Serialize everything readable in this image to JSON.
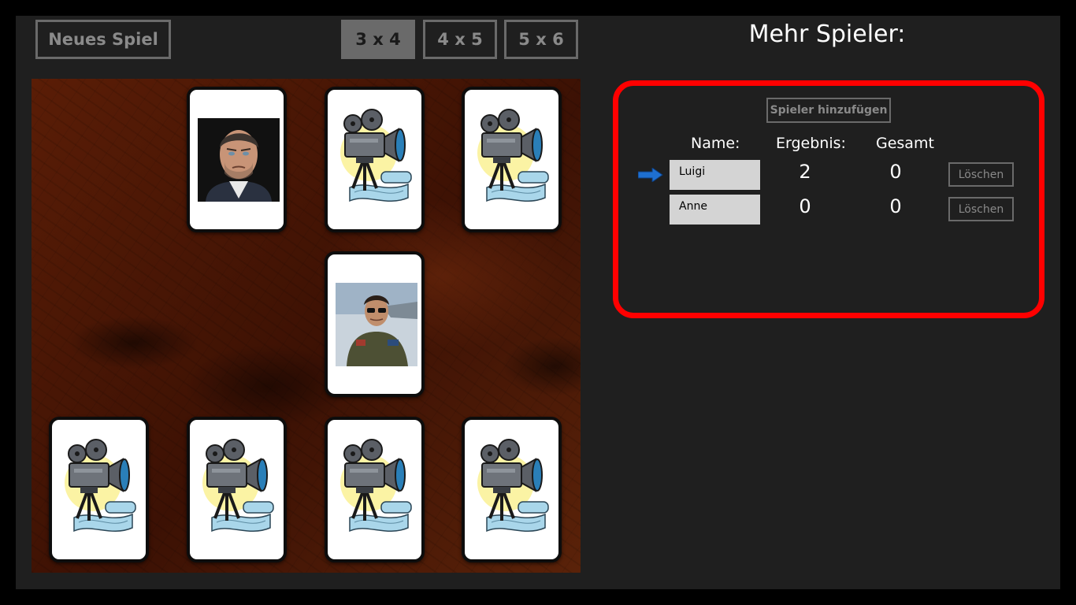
{
  "toolbar": {
    "new_game_label": "Neues Spiel",
    "sizes": [
      {
        "label": "3 x 4",
        "active": true
      },
      {
        "label": "4 x 5",
        "active": false
      },
      {
        "label": "5 x 6",
        "active": false
      }
    ]
  },
  "board": {
    "grid": "3 x 4",
    "cards": [
      {
        "row": 0,
        "col": 0,
        "state": "removed"
      },
      {
        "row": 0,
        "col": 1,
        "state": "face-up",
        "image": "man-portrait-photo"
      },
      {
        "row": 0,
        "col": 2,
        "state": "face-down",
        "image": "movie-camera-card-back"
      },
      {
        "row": 0,
        "col": 3,
        "state": "face-down",
        "image": "movie-camera-card-back"
      },
      {
        "row": 1,
        "col": 0,
        "state": "removed"
      },
      {
        "row": 1,
        "col": 1,
        "state": "removed"
      },
      {
        "row": 1,
        "col": 2,
        "state": "face-up",
        "image": "pilot-photo"
      },
      {
        "row": 1,
        "col": 3,
        "state": "removed"
      },
      {
        "row": 2,
        "col": 0,
        "state": "face-down",
        "image": "movie-camera-card-back"
      },
      {
        "row": 2,
        "col": 1,
        "state": "face-down",
        "image": "movie-camera-card-back"
      },
      {
        "row": 2,
        "col": 2,
        "state": "face-down",
        "image": "movie-camera-card-back"
      },
      {
        "row": 2,
        "col": 3,
        "state": "face-down",
        "image": "movie-camera-card-back"
      }
    ]
  },
  "multiplayer": {
    "title": "Mehr Spieler:",
    "add_player_label": "Spieler hinzufügen",
    "headers": {
      "name": "Name:",
      "score": "Ergebnis:",
      "total": "Gesamt"
    },
    "current_player_icon": "right-arrow-icon",
    "players": [
      {
        "name": "Luigi",
        "score": "2",
        "total": "0",
        "delete_label": "Löschen"
      },
      {
        "name": "Anne",
        "score": "0",
        "total": "0",
        "delete_label": "Löschen"
      }
    ]
  },
  "colors": {
    "background": "#1f1f1f",
    "panel_border": "#ff0000",
    "arrow": "#1e6fd0",
    "active_button": "#6a6a6a"
  }
}
